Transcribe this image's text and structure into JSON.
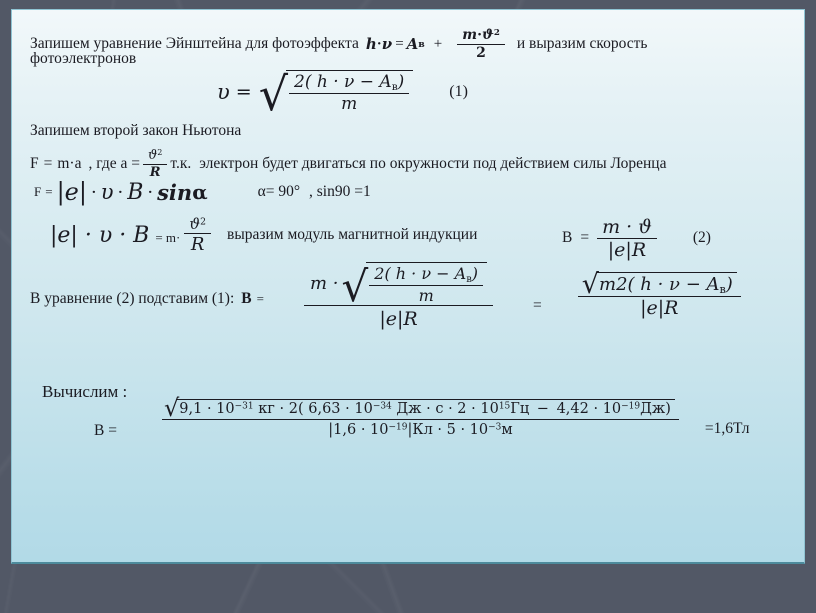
{
  "theme": {
    "backdrop_color": "#525866",
    "panel_top_color": "#f2f8fa",
    "panel_bottom_color": "#b2dae7",
    "text_color": "#1b1b22"
  },
  "lines": {
    "l1_a": "Запишем уравнение Эйнштейна для фотоэффекта",
    "l1_einstein_h": "h",
    "l1_dot": "·",
    "l1_nu": "ν",
    "l1_eq": "=",
    "l1_A": "A",
    "l1_A_sub": "в",
    "l1_plus": "+",
    "l1_frac_num_m": "m",
    "l1_frac_num_dot": "·",
    "l1_frac_num_theta": "ϑ",
    "l1_frac_num_sup": "2",
    "l1_frac_den": "2",
    "l1_b": "и выразим скорость",
    "l2": "фотоэлектронов",
    "eq1_v": "υ",
    "eq1_eq": "=",
    "eq1_radsign": "√",
    "eq1_num": "2( h · ν − A",
    "eq1_num_sub": "в",
    "eq1_num_close": ")",
    "eq1_den": "m",
    "eq1_label": "(1)",
    "l3": "Запишем второй закон Ньютона",
    "l4_F": "F",
    "l4_eq": "=",
    "l4_ma": "m·a",
    "l4_mid": ", где a =",
    "l4_frac_num": "ϑ",
    "l4_frac_num_sup": "2",
    "l4_frac_den": "R",
    "l4_tk": "т.к.",
    "l4_tail": "электрон будет двигаться по окружности под действием силы Лоренца",
    "l5_F": "F",
    "l5_eq": "=",
    "l5_e": "|e|",
    "l5_dot1": "·",
    "l5_v": "υ",
    "l5_dot2": "·",
    "l5_B": "B",
    "l5_dot3": "·",
    "l5_sin": "sin",
    "l5_alpha": "α",
    "l5_cond1": "α= 90°",
    "l5_cond2": ", sin90 =1",
    "l6_lhs": "|e| · υ · B",
    "l6_eq": "= m·",
    "l6_frac_num": "ϑ",
    "l6_frac_num_sup": "2",
    "l6_frac_den": "R",
    "l6_text": "выразим модуль магнитной индукции",
    "l6_B": "B",
    "l6_eq2": "=",
    "l6_frac2_num": "m · ϑ",
    "l6_frac2_den": "|e|R",
    "l6_label": "(2)",
    "l7_text": "В уравнение (2)  подставим  (1):",
    "l7_B": "В",
    "l7_eq": "=",
    "l7_m_dot": "m ·",
    "l7_inner_num": "2( h · ν − A",
    "l7_inner_num_sub": "в",
    "l7_inner_num_close": ")",
    "l7_inner_den": "m",
    "l7_outer_den": "|e|R",
    "l7_eq2": "=",
    "l7_r_num": "m2( h · ν − A",
    "l7_r_num_sub": "в",
    "l7_r_num_close": ")",
    "l7_r_den": "|e|R",
    "l8_title": "Вычислим :",
    "l8_B": "B =",
    "l8_num": "9,1 · 10⁻³¹ кг · 2( 6,63 · 10⁻³⁴ Дж · с · 2 · 10¹⁵Гц − 4,42 · 10⁻¹⁹Дж)",
    "l8_den": "|1,6 · 10⁻¹⁹|Кл · 5 · 10⁻³м",
    "l8_result": "=1,6Тл"
  },
  "calc_numerator": {
    "mass": "9,1",
    "mass_exp": "−31",
    "mass_unit": "кг",
    "factor": "2",
    "planck": "6,63",
    "planck_exp": "−34",
    "planck_unit": "Дж · с",
    "freq": "2",
    "freq_exp": "15",
    "freq_unit": "Гц",
    "minus": "−",
    "work": "4,42",
    "work_exp": "−19",
    "work_unit": "Дж"
  },
  "calc_denominator": {
    "charge": "1,6",
    "charge_exp": "−19",
    "charge_unit": "Кл",
    "radius": "5",
    "radius_exp": "−3",
    "radius_unit": "м"
  }
}
